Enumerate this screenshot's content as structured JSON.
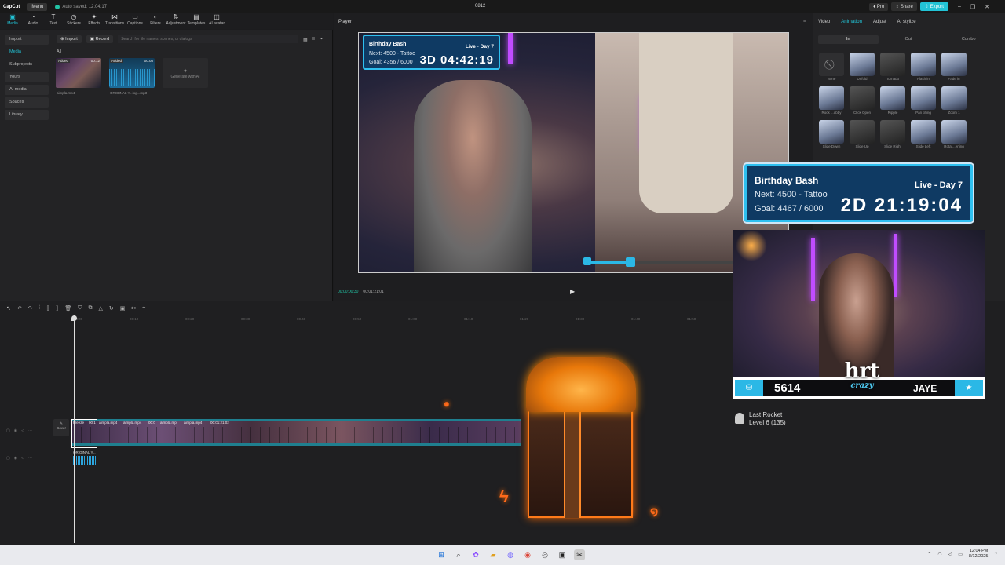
{
  "titlebar": {
    "logo": "CapCut",
    "menu": "Menu",
    "autosave": "Auto saved: 12:04:17",
    "title": "0812",
    "pro": "Pro",
    "share": "Share",
    "export": "Export"
  },
  "tools": [
    "Media",
    "Audio",
    "Text",
    "Stickers",
    "Effects",
    "Transitions",
    "Captions",
    "Filters",
    "Adjustment",
    "Templates",
    "AI avatar"
  ],
  "media_sidebar": [
    "Import",
    "Media",
    "Subprojects",
    "Yours",
    "AI media",
    "Spaces",
    "Library"
  ],
  "media_toolbar": {
    "import": "Import",
    "record": "Record",
    "search_placeholder": "Search for file names, scenes, or dialogs"
  },
  "media": {
    "all_label": "All",
    "items": [
      {
        "badge": "Added",
        "duration": "00:12",
        "name": "aimpla.mp4"
      },
      {
        "badge": "Added",
        "duration": "00:08",
        "name": "ORIGINAL Y...log...mp3"
      },
      {
        "badge": "",
        "duration": "",
        "name": "Generate with AI"
      }
    ]
  },
  "player": {
    "title": "Player",
    "current_time": "00:00:00:30",
    "total_time": "00:01:21:01"
  },
  "goal_small": {
    "title": "Birthday Bash",
    "live": "Live - Day 7",
    "next": "Next: 4500 - Tattoo",
    "goal": "Goal: 4356 / 6000",
    "timer": "3D 04:42:19"
  },
  "goal_large": {
    "title": "Birthday Bash",
    "live": "Live - Day 7",
    "next": "Next: 4500 - Tattoo",
    "goal": "Goal: 4467 / 6000",
    "timer": "2D 21:19:04"
  },
  "right_panel": {
    "tabs": [
      "Video",
      "Animation",
      "Adjust",
      "AI stylize"
    ],
    "subtabs": [
      "In",
      "Out",
      "Combo"
    ],
    "animations": [
      "None",
      "Unfold",
      "Tornado",
      "Flash in",
      "Fade in",
      "Rock ...ubby",
      "Click Open",
      "Ripple",
      "Pan tilting",
      "Zoom 1",
      "Slide Down",
      "Slide Up",
      "Slide Right",
      "Slide Left",
      "Rotat...ening"
    ]
  },
  "timeline": {
    "ruler": [
      "00:00",
      "00:10",
      "00:20",
      "00:30",
      "00:40",
      "00:50",
      "01:00",
      "01:10",
      "01:20",
      "01:30",
      "01:40",
      "01:50"
    ],
    "cover_label": "Cover",
    "video_labels": [
      "Freeze",
      "00:1",
      "aimpla.mp4",
      "aimpla.mp4",
      "00:0",
      "aimpla.mp",
      "aimpla.mp4",
      "00:01:21:02"
    ],
    "audio_label": "ORIGINAL Y..."
  },
  "stream": {
    "count": "5614",
    "name": "JAYE",
    "logo_text": "hrt",
    "logo_sub": "crazy",
    "rocket_title": "Last Rocket",
    "rocket_level": "Level 6 (135)"
  },
  "taskbar": {
    "time": "12:04 PM",
    "date": "8/12/2025"
  }
}
